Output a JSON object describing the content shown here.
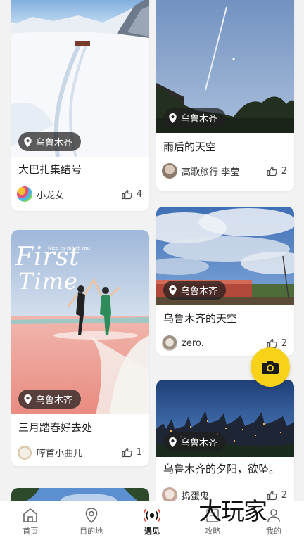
{
  "feed": {
    "cards": [
      {
        "location": "乌鲁木齐",
        "title": "大巴扎集结号",
        "author": "小龙女",
        "likes": "4"
      },
      {
        "location": "乌鲁木齐",
        "title": "雨后的天空",
        "author": "高歌旅行 李莹",
        "likes": "2"
      },
      {
        "location": "乌鲁木齐",
        "title": "三月踏春好去处",
        "author": "哼首小曲儿",
        "likes": "1",
        "photo_text": {
          "line1": "First",
          "line2": "Time",
          "small": "Nice to meet you"
        }
      },
      {
        "location": "乌鲁木齐",
        "title": "乌鲁木齐的天空",
        "author": "zero.",
        "likes": "2"
      },
      {
        "location": "乌鲁木齐",
        "title": "乌鲁木齐的夕阳，欲坠。",
        "author": "捣蛋鬼",
        "likes": "2"
      }
    ]
  },
  "tabs": [
    {
      "label": "首页",
      "icon": "home-icon"
    },
    {
      "label": "目的地",
      "icon": "location-pin-icon"
    },
    {
      "label": "遇见",
      "icon": "broadcast-icon",
      "active": true
    },
    {
      "label": "攻略",
      "icon": "guide-icon"
    },
    {
      "label": "我的",
      "icon": "profile-icon"
    }
  ],
  "watermark": "大玩家",
  "colors": {
    "accent": "#f7d219",
    "badge_bg": "#1e1e1e"
  }
}
